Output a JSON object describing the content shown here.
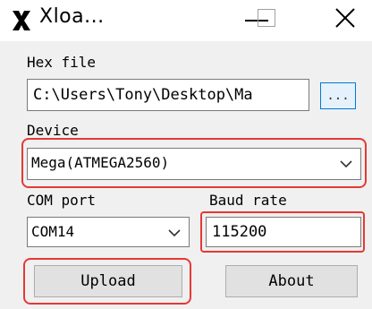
{
  "window": {
    "title": "Xloa...",
    "app_icon": "xloader-x-icon",
    "controls": [
      "minimize-icon",
      "maximize-icon",
      "close-icon"
    ]
  },
  "hex_file": {
    "label": "Hex file",
    "value": "C:\\Users\\Tony\\Desktop\\Ma",
    "browse_label": "..."
  },
  "device": {
    "label": "Device",
    "selected": "Mega(ATMEGA2560)"
  },
  "com_port": {
    "label": "COM port",
    "selected": "COM14"
  },
  "baud_rate": {
    "label": "Baud rate",
    "value": "115200"
  },
  "buttons": {
    "upload": "Upload",
    "about": "About"
  },
  "colors": {
    "highlight": "#e53935",
    "window_bg": "#f0f0f0",
    "focus_border": "#0078d7"
  }
}
